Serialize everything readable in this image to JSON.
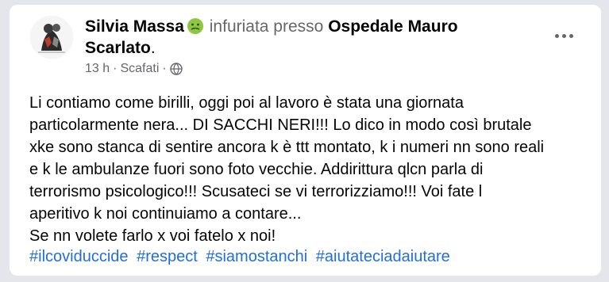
{
  "post": {
    "author": "Silvia Massa",
    "emoji_icon": "nauseated-face-icon",
    "activity": "infuriata presso",
    "place": "Ospedale Mauro Scarlato",
    "place_end": ".",
    "time": "13 h",
    "separator": "·",
    "location": "Scafati",
    "separator2": "·",
    "privacy_icon": "globe-icon",
    "more_icon": "more-options-icon",
    "body_lines": [
      "Li contiamo come birilli, oggi poi al lavoro è stata una giornata",
      "particolarmente nera... DI SACCHI NERI!!! Lo dico in modo così brutale",
      "xke sono stanca di sentire ancora k è ttt montato, k i numeri nn sono reali",
      "e k le ambulanze fuori sono foto vecchie. Addirittura qlcn parla di",
      "terrorismo psicologico!!! Scusateci se vi terrorizziamo!!! Voi fate l",
      "aperitivo k noi continuiamo a contare...",
      "Se nn volete farlo x voi fatelo x noi!"
    ],
    "hashtags": [
      "#ilcoviduccide",
      "#respect",
      "#siamostanchi",
      "#aiutateciadaiutare"
    ]
  },
  "colors": {
    "link": "#216fdb",
    "secondary_text": "#65676b",
    "primary_text": "#050505",
    "emoji_face": "#8dc63f"
  }
}
